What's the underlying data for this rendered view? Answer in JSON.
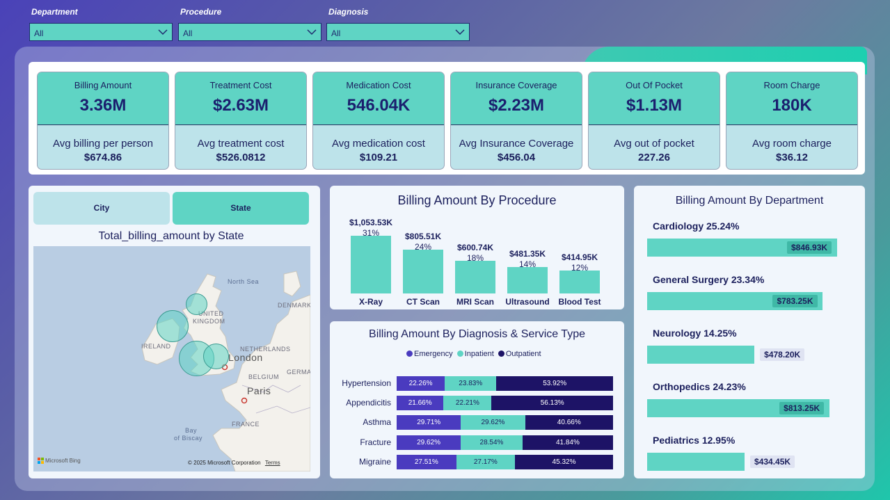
{
  "filters": [
    {
      "label": "Department",
      "value": "All"
    },
    {
      "label": "Procedure",
      "value": "All"
    },
    {
      "label": "Diagnosis",
      "value": "All"
    }
  ],
  "kpis": [
    {
      "title": "Billing Amount",
      "value": "3.36M",
      "sub_label": "Avg billing per person",
      "sub_value": "$674.86"
    },
    {
      "title": "Treatment Cost",
      "value": "$2.63M",
      "sub_label": "Avg treatment cost",
      "sub_value": "$526.0812"
    },
    {
      "title": "Medication Cost",
      "value": "546.04K",
      "sub_label": "Avg medication cost",
      "sub_value": "$109.21"
    },
    {
      "title": "Insurance Coverage",
      "value": "$2.23M",
      "sub_label": "Avg Insurance Coverage",
      "sub_value": "$456.04"
    },
    {
      "title": "Out Of Pocket",
      "value": "$1.13M",
      "sub_label": "Avg out of pocket",
      "sub_value": "227.26"
    },
    {
      "title": "Room Charge",
      "value": "180K",
      "sub_label": "Avg room charge",
      "sub_value": "$36.12"
    }
  ],
  "map": {
    "toggle": {
      "city": "City",
      "state": "State",
      "active": "State"
    },
    "title": "Total_billing_amount by State",
    "labels": {
      "north_sea": "North Sea",
      "uk1": "UNITED",
      "uk2": "KINGDOM",
      "denmark": "DENMARK",
      "ireland": "IRELAND",
      "netherlands": "NETHERLANDS",
      "london": "London",
      "germany": "GERMA",
      "belgium": "BELGIUM",
      "paris": "Paris",
      "france": "FRANCE",
      "bay1": "Bay",
      "bay2": "of Biscay"
    },
    "logo": "Microsoft Bing",
    "copyright": "© 2025 Microsoft Corporation",
    "terms": "Terms",
    "colors": {
      "sea": "#b9cde3",
      "land": "#f3f1ec",
      "bubble": "#5fd4c4"
    }
  },
  "procedure_chart": {
    "title": "Billing Amount By Procedure",
    "chart_data": {
      "type": "bar",
      "categories": [
        "X-Ray",
        "CT Scan",
        "MRI Scan",
        "Ultrasound",
        "Blood Test"
      ],
      "values": [
        1053.53,
        805.51,
        600.74,
        481.35,
        414.95
      ],
      "value_labels": [
        "$1,053.53K",
        "$805.51K",
        "$600.74K",
        "$481.35K",
        "$414.95K"
      ],
      "percent_labels": [
        "31%",
        "24%",
        "18%",
        "14%",
        "12%"
      ],
      "ylim": [
        0,
        1053.53
      ]
    }
  },
  "diagnosis_chart": {
    "title": "Billing Amount By Diagnosis & Service Type",
    "chart_data": {
      "type": "bar",
      "stacked": true,
      "orientation": "horizontal",
      "categories": [
        "Hypertension",
        "Appendicitis",
        "Asthma",
        "Fracture",
        "Migraine"
      ],
      "series": [
        {
          "name": "Emergency",
          "color": "#4a3bbf",
          "values": [
            22.26,
            21.66,
            29.71,
            29.62,
            27.51
          ],
          "labels": [
            "22.26%",
            "21.66%",
            "29.71%",
            "29.62%",
            "27.51%"
          ]
        },
        {
          "name": "Inpatient",
          "color": "#5fd4c4",
          "values": [
            23.83,
            22.21,
            29.62,
            28.54,
            27.17
          ],
          "labels": [
            "23.83%",
            "22.21%",
            "29.62%",
            "28.54%",
            "27.17%"
          ]
        },
        {
          "name": "Outpatient",
          "color": "#1d1366",
          "values": [
            53.92,
            56.13,
            40.66,
            41.84,
            45.32
          ],
          "labels": [
            "53.92%",
            "56.13%",
            "40.66%",
            "41.84%",
            "45.32%"
          ]
        }
      ]
    }
  },
  "department_chart": {
    "title": "Billing Amount By Department",
    "chart_data": {
      "type": "bar",
      "orientation": "horizontal",
      "categories": [
        "Cardiology",
        "General Surgery",
        "Neurology",
        "Orthopedics",
        "Pediatrics"
      ],
      "category_labels": [
        "Cardiology 25.24%",
        "General Surgery 23.34%",
        "Neurology 14.25%",
        "Orthopedics 24.23%",
        "Pediatrics 12.95%"
      ],
      "values": [
        846.93,
        783.25,
        478.2,
        813.25,
        434.45
      ],
      "value_labels": [
        "$846.93K",
        "$783.25K",
        "$478.20K",
        "$813.25K",
        "$434.45K"
      ],
      "xlim": [
        0,
        846.93
      ]
    }
  }
}
